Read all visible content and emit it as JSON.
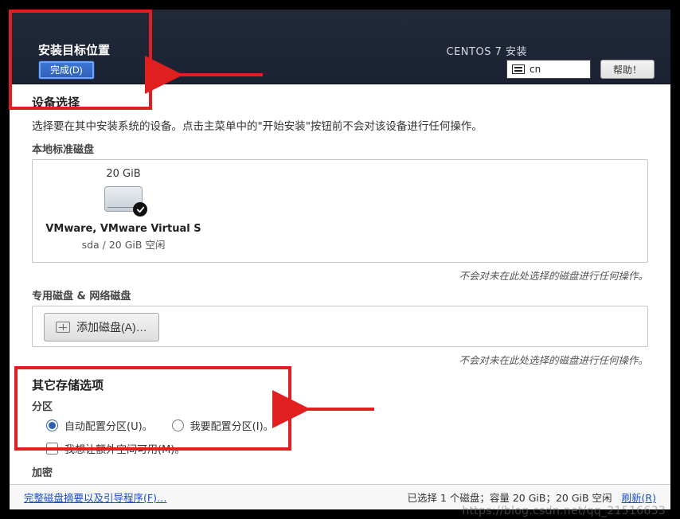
{
  "header": {
    "title": "安装目标位置",
    "done_label": "完成(D)",
    "product_title": "CENTOS 7 安装",
    "input_method": "cn",
    "help_label": "帮助！"
  },
  "body": {
    "section_title": "设备选择",
    "intro": "选择要在其中安装系统的设备。点击主菜单中的\"开始安装\"按钮前不会对该设备进行任何操作。",
    "local_head": "本地标准磁盘",
    "disk": {
      "size": "20 GiB",
      "name": "VMware, VMware Virtual S",
      "sub": "sda   /   20 GiB 空闲"
    },
    "hint_noop": "不会对未在此处选择的磁盘进行任何操作。",
    "special_head": "专用磁盘 & 网络磁盘",
    "add_disk_label": "添加磁盘(A)…",
    "other_title": "其它存储选项",
    "partition_head": "分区",
    "radio_auto": "自动配置分区(U)。",
    "radio_manual": "我要配置分区(I)。",
    "chk_extra": "我想让额外空间可用(M)。",
    "encrypt_head": "加密"
  },
  "footer": {
    "summary_link": "完整磁盘摘要以及引导程序(F)…",
    "status": "已选择 1 个磁盘；容量 20 GiB；20 GiB 空闲",
    "refresh": "刷新(R)"
  },
  "watermark": "https://blog.csdn.net/qq_21516633"
}
